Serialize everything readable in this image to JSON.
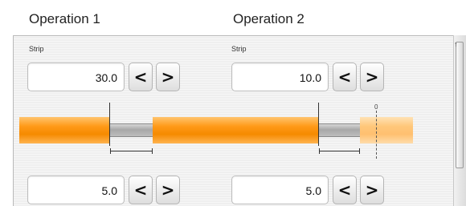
{
  "headers": {
    "operation1": "Operation 1",
    "operation2": "Operation 2"
  },
  "operation1": {
    "strip_label": "Strip",
    "strip_value": "30.0",
    "second_value": "5.0"
  },
  "operation2": {
    "strip_label": "Strip",
    "strip_value": "10.0",
    "second_value": "5.0",
    "zero_marker": "0"
  },
  "buttons": {
    "decrement_glyph": "<",
    "increment_glyph": ">"
  },
  "colors": {
    "insulation": "#f58a00",
    "conductor": "#a8a8a8"
  }
}
